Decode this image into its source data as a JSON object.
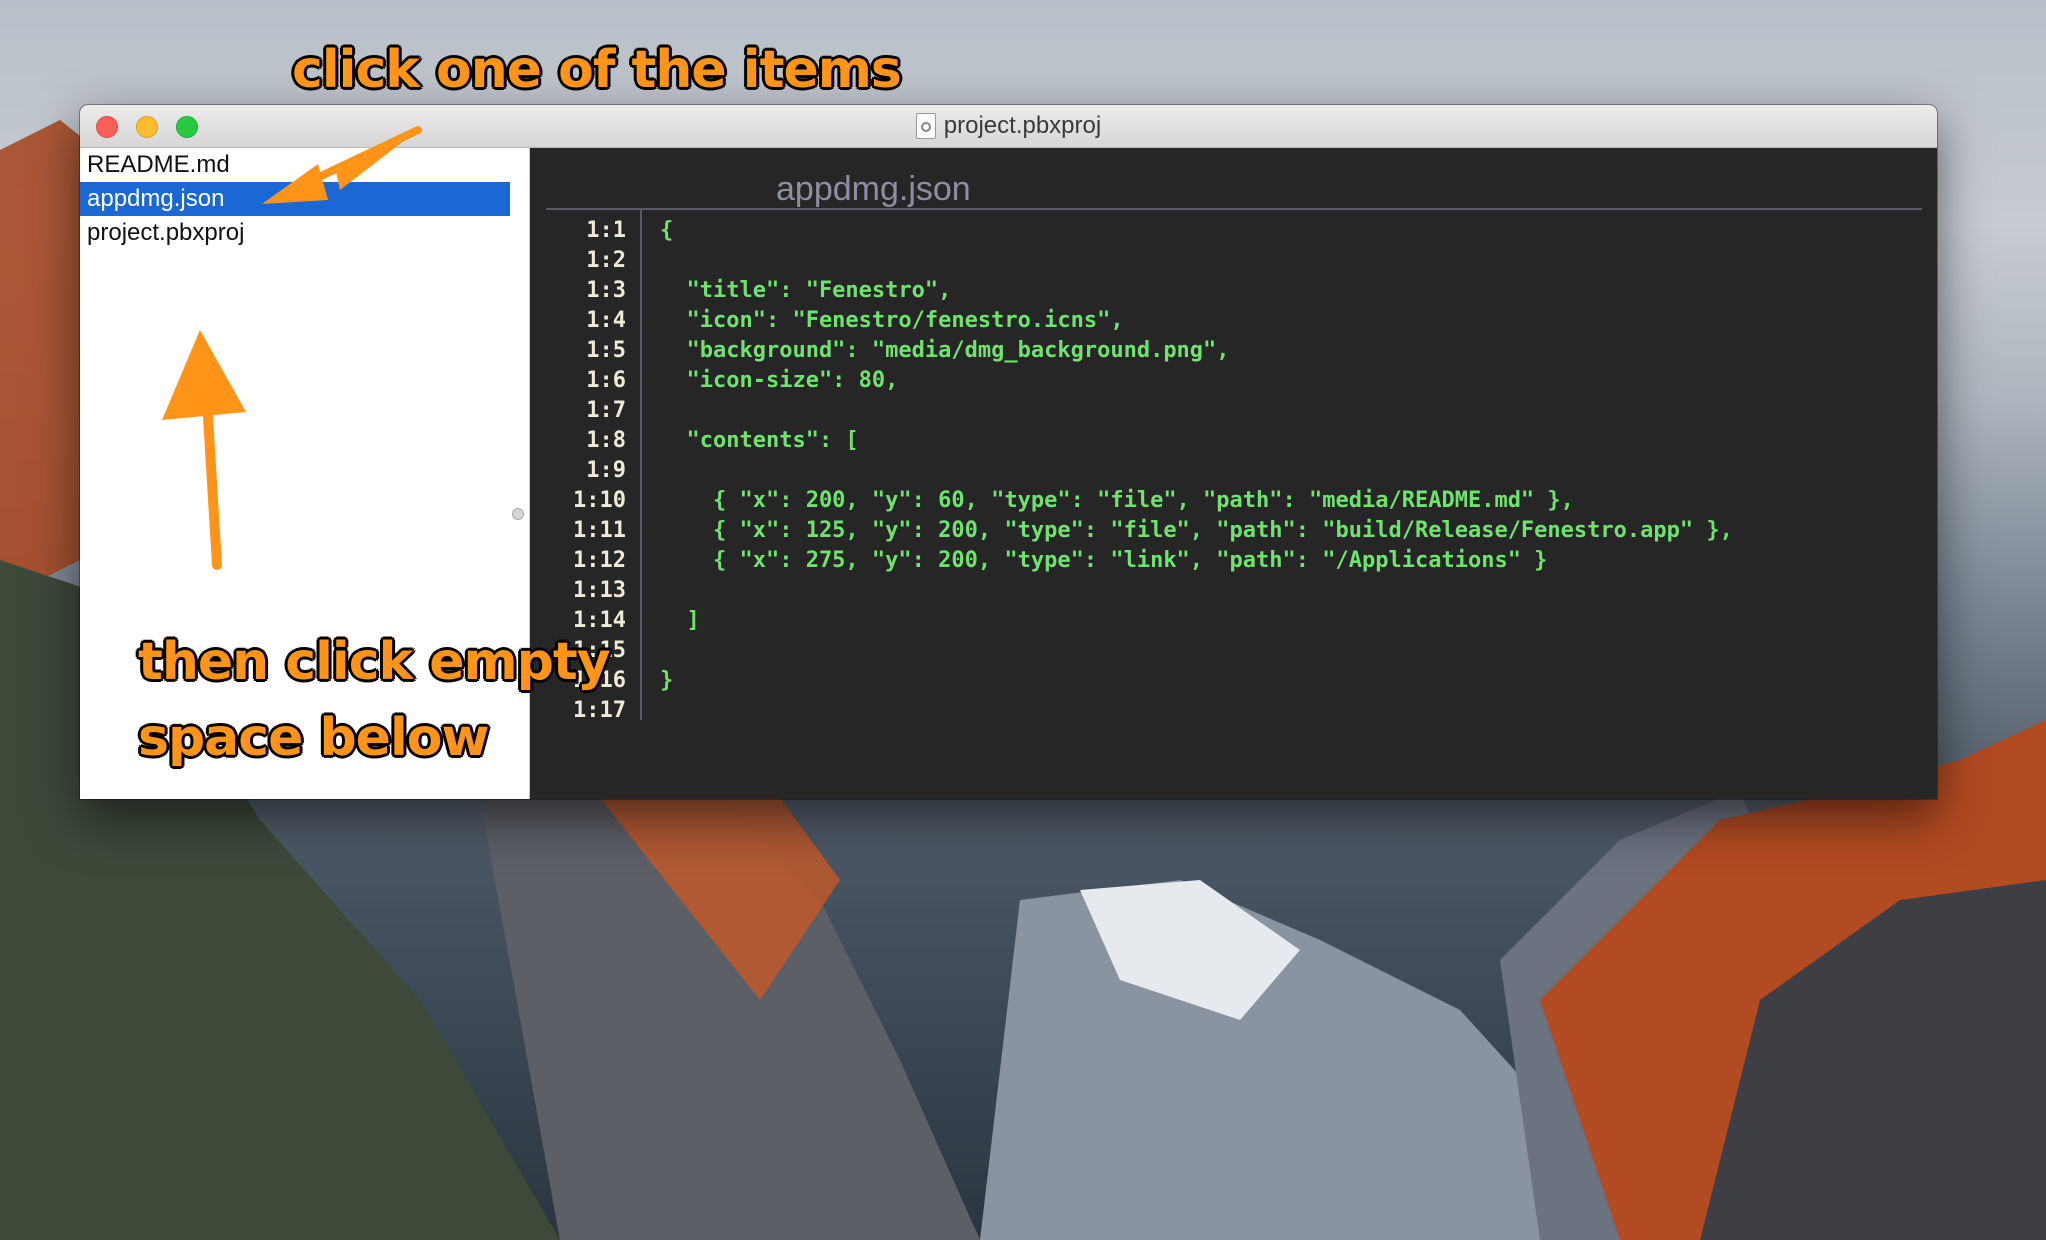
{
  "window": {
    "title": "project.pbxproj"
  },
  "sidebar": {
    "items": [
      {
        "label": "README.md",
        "selected": false
      },
      {
        "label": "appdmg.json",
        "selected": true
      },
      {
        "label": "project.pbxproj",
        "selected": false
      }
    ]
  },
  "editor": {
    "filename": "appdmg.json",
    "lines": [
      {
        "num": "1:1",
        "text": "{"
      },
      {
        "num": "1:2",
        "text": ""
      },
      {
        "num": "1:3",
        "text": "  \"title\": \"Fenestro\","
      },
      {
        "num": "1:4",
        "text": "  \"icon\": \"Fenestro/fenestro.icns\","
      },
      {
        "num": "1:5",
        "text": "  \"background\": \"media/dmg_background.png\","
      },
      {
        "num": "1:6",
        "text": "  \"icon-size\": 80,"
      },
      {
        "num": "1:7",
        "text": ""
      },
      {
        "num": "1:8",
        "text": "  \"contents\": ["
      },
      {
        "num": "1:9",
        "text": ""
      },
      {
        "num": "1:10",
        "text": "    { \"x\": 200, \"y\": 60, \"type\": \"file\", \"path\": \"media/README.md\" },"
      },
      {
        "num": "1:11",
        "text": "    { \"x\": 125, \"y\": 200, \"type\": \"file\", \"path\": \"build/Release/Fenestro.app\" },"
      },
      {
        "num": "1:12",
        "text": "    { \"x\": 275, \"y\": 200, \"type\": \"link\", \"path\": \"/Applications\" }"
      },
      {
        "num": "1:13",
        "text": ""
      },
      {
        "num": "1:14",
        "text": "  ]"
      },
      {
        "num": "1:15",
        "text": ""
      },
      {
        "num": "1:16",
        "text": "}"
      },
      {
        "num": "1:17",
        "text": ""
      }
    ]
  },
  "annotations": {
    "top": "click one of the items",
    "bottom_line1": "then click empty",
    "bottom_line2": "space below"
  },
  "colors": {
    "accent": "#ff9418",
    "selection": "#1a68d6",
    "code_text": "#6fe26f",
    "editor_bg": "#262626"
  },
  "icons": [
    "close-button",
    "minimize-button",
    "zoom-button",
    "document-icon",
    "arrow-icon"
  ]
}
